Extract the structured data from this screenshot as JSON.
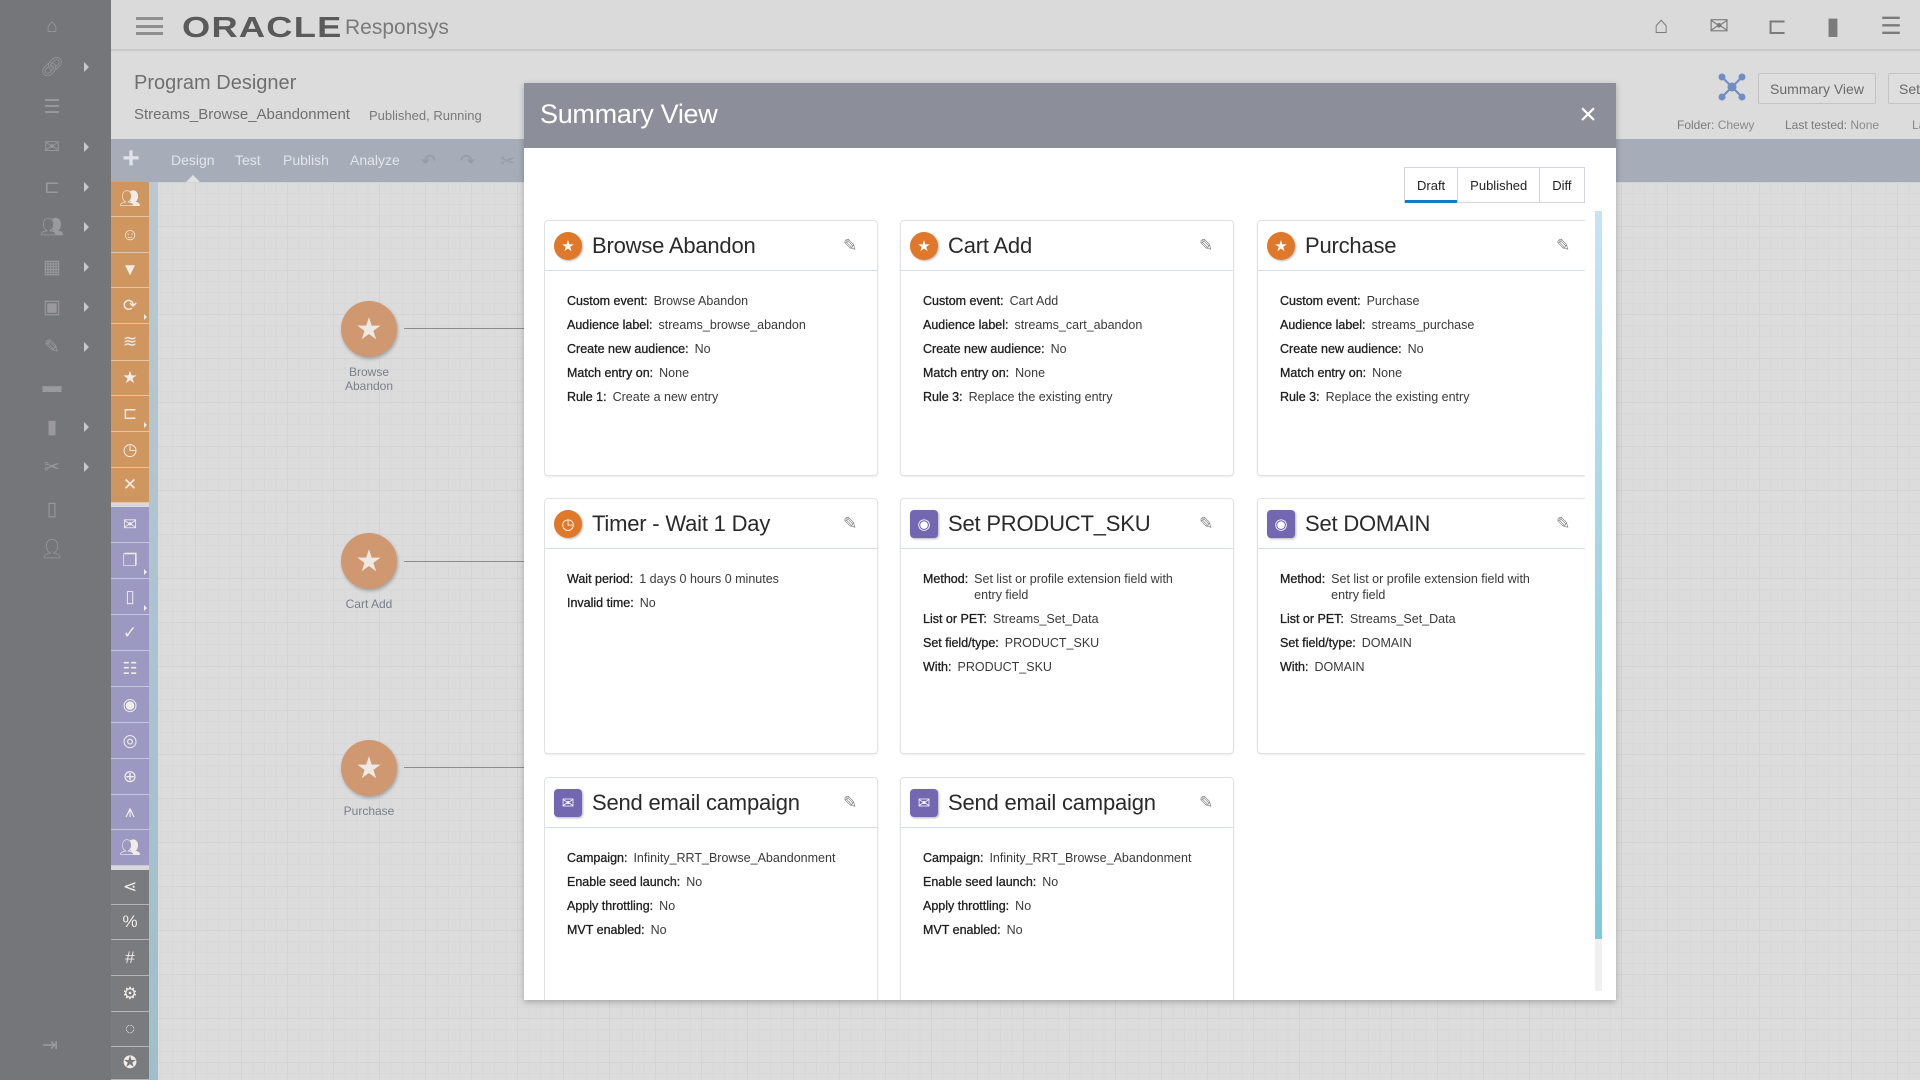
{
  "app": {
    "brand": "ORACLE",
    "product": "Responsys"
  },
  "top_nav_icons": [
    "home-icon",
    "email-icon",
    "program-icon",
    "insights-icon",
    "tasks-icon"
  ],
  "left_nav": {
    "items": [
      {
        "icon": "home-icon",
        "has_submenu": false
      },
      {
        "icon": "link-icon",
        "has_submenu": true
      },
      {
        "icon": "tasks-icon",
        "has_submenu": false
      },
      {
        "icon": "email-icon",
        "has_submenu": true
      },
      {
        "icon": "program-icon",
        "has_submenu": true
      },
      {
        "icon": "audience-icon",
        "has_submenu": true
      },
      {
        "icon": "table-icon",
        "has_submenu": true
      },
      {
        "icon": "image-icon",
        "has_submenu": true
      },
      {
        "icon": "form-icon",
        "has_submenu": true
      },
      {
        "icon": "folder-icon",
        "has_submenu": false
      },
      {
        "icon": "chart-icon",
        "has_submenu": true
      },
      {
        "icon": "tools-icon",
        "has_submenu": true
      },
      {
        "icon": "mobile-icon",
        "has_submenu": false
      },
      {
        "icon": "user-icon",
        "has_submenu": false
      }
    ],
    "logout_icon": "logout-icon"
  },
  "page": {
    "title": "Program Designer",
    "program_name": "Streams_Browse_Abandonment",
    "status": "Published, Running",
    "summary_view_button": "Summary View",
    "settings_button_partial": "Set",
    "meta": {
      "folder_label": "Folder:",
      "folder_value": "Chewy",
      "last_tested_label": "Last tested:",
      "last_tested_value": "None",
      "third_partial": "La"
    }
  },
  "toolbar": {
    "tabs": [
      "Design",
      "Test",
      "Publish",
      "Analyze"
    ],
    "active_tab": "Design",
    "icons": [
      "undo-icon",
      "redo-icon",
      "cut-icon"
    ]
  },
  "canvas": {
    "nodes": [
      {
        "label": "Browse\nAbandon",
        "icon": "star-icon"
      },
      {
        "label": "Cart Add",
        "icon": "star-icon"
      },
      {
        "label": "Purchase",
        "icon": "star-icon"
      }
    ]
  },
  "modal": {
    "title": "Summary View",
    "close_label": "×",
    "tabs": [
      {
        "label": "Draft",
        "active": true
      },
      {
        "label": "Published",
        "active": false
      },
      {
        "label": "Diff",
        "active": false
      }
    ],
    "cards": [
      {
        "title": "Browse Abandon",
        "icon": "star-icon",
        "icon_color": "#e0782a",
        "fields": [
          {
            "k": "Custom event:",
            "v": "Browse Abandon"
          },
          {
            "k": "Audience label:",
            "v": "streams_browse_abandon"
          },
          {
            "k": "Create new audience:",
            "v": "No"
          },
          {
            "k": "Match entry on:",
            "v": "None"
          },
          {
            "k": "Rule 1:",
            "v": "Create a new entry"
          }
        ]
      },
      {
        "title": "Cart Add",
        "icon": "star-icon",
        "icon_color": "#e0782a",
        "fields": [
          {
            "k": "Custom event:",
            "v": "Cart Add"
          },
          {
            "k": "Audience label:",
            "v": "streams_cart_abandon"
          },
          {
            "k": "Create new audience:",
            "v": "No"
          },
          {
            "k": "Match entry on:",
            "v": "None"
          },
          {
            "k": "Rule 3:",
            "v": "Replace the existing entry"
          }
        ]
      },
      {
        "title": "Purchase",
        "icon": "star-icon",
        "icon_color": "#e0782a",
        "fields": [
          {
            "k": "Custom event:",
            "v": "Purchase"
          },
          {
            "k": "Audience label:",
            "v": "streams_purchase"
          },
          {
            "k": "Create new audience:",
            "v": "No"
          },
          {
            "k": "Match entry on:",
            "v": "None"
          },
          {
            "k": "Rule 3:",
            "v": "Replace the existing entry"
          }
        ]
      },
      {
        "title": "Timer - Wait 1 Day",
        "icon": "timer-icon",
        "icon_color": "#e0782a",
        "fields": [
          {
            "k": "Wait period:",
            "v": "1 days 0 hours 0 minutes"
          },
          {
            "k": "Invalid time:",
            "v": "No"
          }
        ]
      },
      {
        "title": "Set PRODUCT_SKU",
        "icon": "set-data-icon",
        "icon_color": "#7467b2",
        "fields": [
          {
            "k": "Method:",
            "v": "Set list or profile extension field with entry field"
          },
          {
            "k": "List or PET:",
            "v": "Streams_Set_Data"
          },
          {
            "k": "Set field/type:",
            "v": "PRODUCT_SKU"
          },
          {
            "k": "With:",
            "v": "PRODUCT_SKU"
          }
        ]
      },
      {
        "title": "Set DOMAIN",
        "icon": "set-data-icon",
        "icon_color": "#7467b2",
        "fields": [
          {
            "k": "Method:",
            "v": "Set list or profile extension field with entry field"
          },
          {
            "k": "List or PET:",
            "v": "Streams_Set_Data"
          },
          {
            "k": "Set field/type:",
            "v": "DOMAIN"
          },
          {
            "k": "With:",
            "v": "DOMAIN"
          }
        ]
      },
      {
        "title": "Send email campaign",
        "icon": "email-icon",
        "icon_color": "#7467b2",
        "fields": [
          {
            "k": "Campaign:",
            "v": "Infinity_RRT_Browse_Abandonment"
          },
          {
            "k": "Enable seed launch:",
            "v": "No"
          },
          {
            "k": "Apply throttling:",
            "v": "No"
          },
          {
            "k": "MVT enabled:",
            "v": "No"
          }
        ]
      },
      {
        "title": "Send email campaign",
        "icon": "email-icon",
        "icon_color": "#7467b2",
        "fields": [
          {
            "k": "Campaign:",
            "v": "Infinity_RRT_Browse_Abandonment"
          },
          {
            "k": "Enable seed launch:",
            "v": "No"
          },
          {
            "k": "Apply throttling:",
            "v": "No"
          },
          {
            "k": "MVT enabled:",
            "v": "No"
          }
        ]
      }
    ]
  },
  "colors": {
    "event_orange": "#e0782a",
    "action_purple": "#7467b2",
    "active_tab_underline": "#0d7ec0",
    "modal_header": "#8c8f99"
  }
}
